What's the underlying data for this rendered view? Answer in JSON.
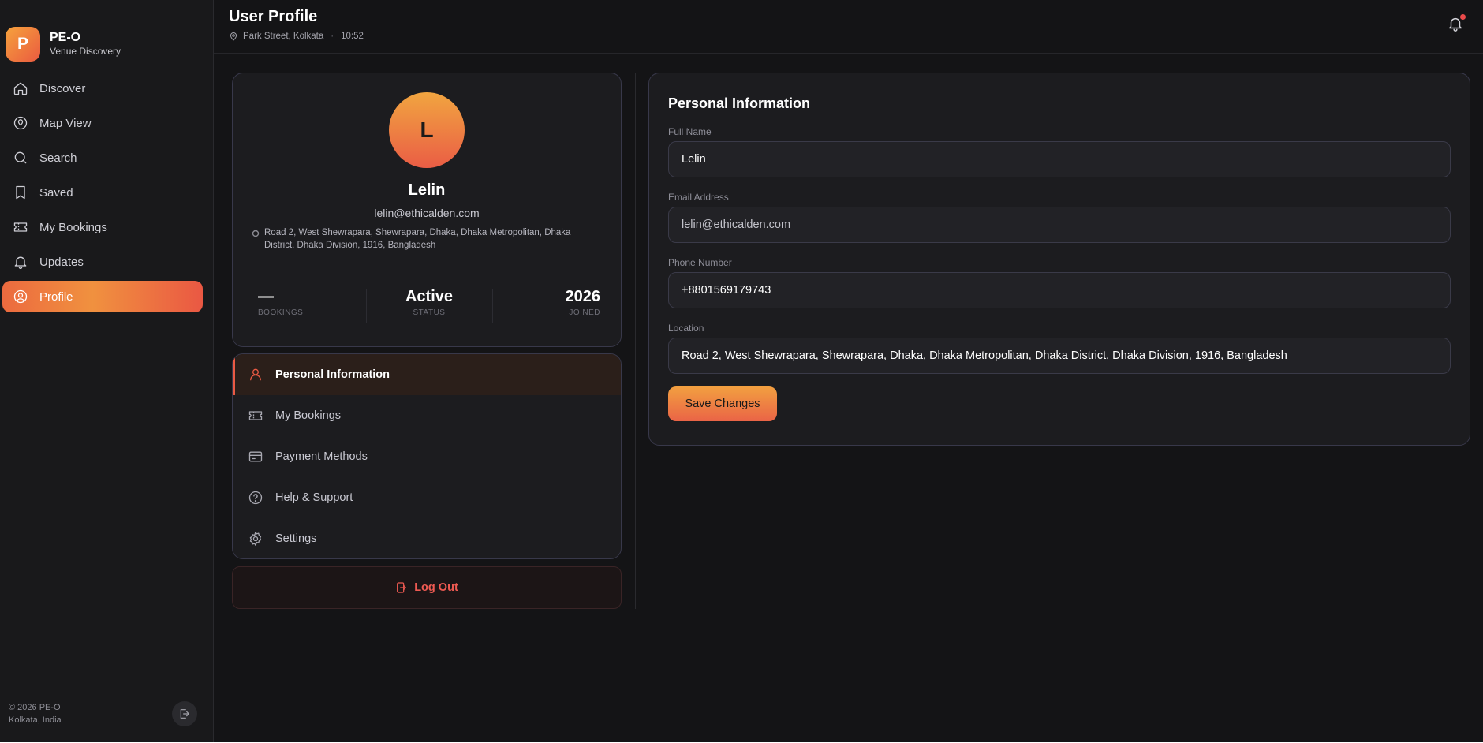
{
  "brand": {
    "logo_letter": "P",
    "name": "PE-O",
    "subtitle": "Venue Discovery"
  },
  "sidebar": {
    "items": [
      {
        "label": "Discover",
        "icon": "home-icon"
      },
      {
        "label": "Map View",
        "icon": "map-pin-icon"
      },
      {
        "label": "Search",
        "icon": "search-icon"
      },
      {
        "label": "Saved",
        "icon": "bookmark-icon"
      },
      {
        "label": "My Bookings",
        "icon": "ticket-icon"
      },
      {
        "label": "Updates",
        "icon": "bell-icon"
      },
      {
        "label": "Profile",
        "icon": "user-circle-icon",
        "active": true
      }
    ],
    "footer": {
      "copyright": "© 2026 PE-O",
      "location": "Kolkata, India"
    }
  },
  "header": {
    "title": "User Profile",
    "location": "Park Street, Kolkata",
    "separator": "·",
    "time": "10:52"
  },
  "profile": {
    "initial": "L",
    "name": "Lelin",
    "email": "lelin@ethicalden.com",
    "address": "Road 2, West Shewrapara, Shewrapara, Dhaka, Dhaka Metropolitan, Dhaka District, Dhaka Division, 1916, Bangladesh",
    "stats": [
      {
        "value": "—",
        "label": "BOOKINGS"
      },
      {
        "value": "Active",
        "label": "STATUS"
      },
      {
        "value": "2026",
        "label": "JOINED"
      }
    ]
  },
  "menu": {
    "items": [
      {
        "label": "Personal Information",
        "icon": "user-icon",
        "active": true
      },
      {
        "label": "My Bookings",
        "icon": "ticket-icon"
      },
      {
        "label": "Payment Methods",
        "icon": "credit-card-icon"
      },
      {
        "label": "Help & Support",
        "icon": "help-circle-icon"
      },
      {
        "label": "Settings",
        "icon": "gear-icon"
      }
    ],
    "logout_label": "Log Out"
  },
  "personal_info": {
    "title": "Personal Information",
    "fields": [
      {
        "label": "Full Name",
        "value": "Lelin"
      },
      {
        "label": "Email Address",
        "value": "lelin@ethicalden.com"
      },
      {
        "label": "Phone Number",
        "value": "+8801569179743"
      },
      {
        "label": "Location",
        "value": "Road 2, West Shewrapara, Shewrapara, Dhaka, Dhaka Metropolitan, Dhaka District, Dhaka Division, 1916, Bangladesh"
      }
    ],
    "save_label": "Save Changes"
  },
  "colors": {
    "accent_start": "#f2a040",
    "accent_end": "#ea5a44",
    "background": "#141416",
    "danger": "#ee5a52"
  }
}
